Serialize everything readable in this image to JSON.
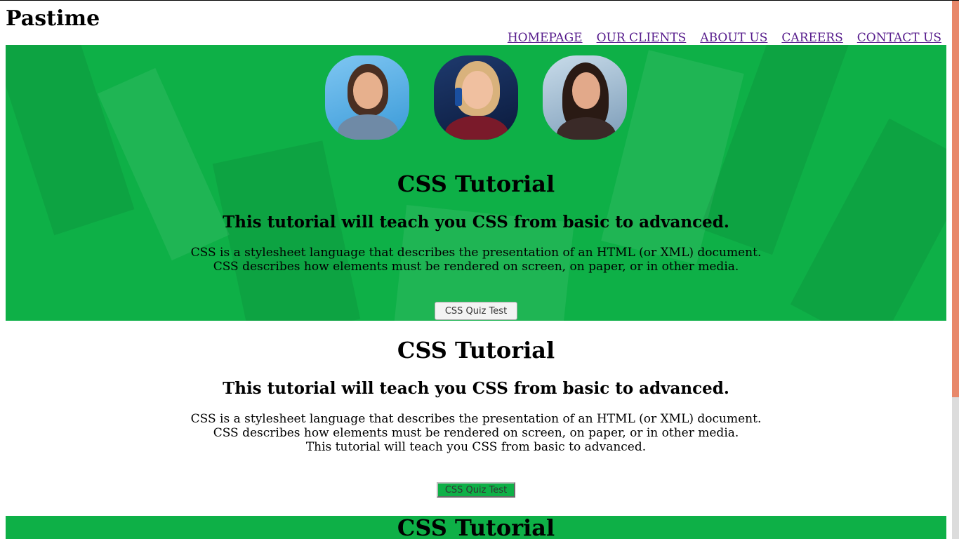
{
  "brand": "Pastime",
  "nav": [
    "HOMEPAGE",
    "OUR CLIENTS",
    "ABOUT US",
    "CAREERS",
    "CONTACT US"
  ],
  "hero": {
    "title": "CSS Tutorial",
    "subtitle": "This tutorial will teach you CSS from basic to advanced.",
    "lines": [
      "CSS is a stylesheet language that describes the presentation of an HTML (or XML) document.",
      "CSS describes how elements must be rendered on screen, on paper, or in other media."
    ],
    "button": "CSS Quiz Test"
  },
  "section2": {
    "title": "CSS Tutorial",
    "subtitle": "This tutorial will teach you CSS from basic to advanced.",
    "lines": [
      "CSS is a stylesheet language that describes the presentation of an HTML (or XML) document.",
      "CSS describes how elements must be rendered on screen, on paper, or in other media.",
      "This tutorial will teach you CSS from basic to advanced."
    ],
    "button": "CSS Quiz Test"
  },
  "section3": {
    "title": "CSS Tutorial"
  },
  "colors": {
    "green": "#0eb047",
    "link": "#551a8b",
    "scroll_thumb": "#e8886a"
  },
  "icons": [
    "portrait-photo-1",
    "portrait-photo-2",
    "portrait-photo-3"
  ]
}
